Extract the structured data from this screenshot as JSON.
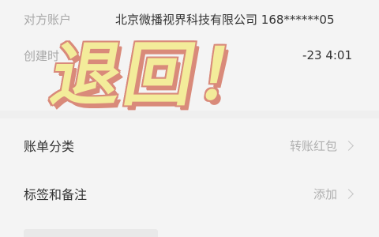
{
  "details": {
    "counterparty_label": "对方账户",
    "counterparty_value": "北京微播视界科技有限公司 168******05",
    "created_label": "创建时",
    "created_value": "-23     4:01"
  },
  "list": {
    "category_label": "账单分类",
    "category_value": "转账红包",
    "tags_label": "标签和备注",
    "tags_value": "添加"
  },
  "overlay": {
    "text": "退回！"
  },
  "colors": {
    "background": "#f4f4f4",
    "overlay_fill": "#f3ec9a",
    "overlay_outline": "#d98a7a",
    "muted_text": "#a8a8a8",
    "primary_text": "#333333"
  },
  "icons": {
    "chevron": "chevron-right-icon"
  }
}
